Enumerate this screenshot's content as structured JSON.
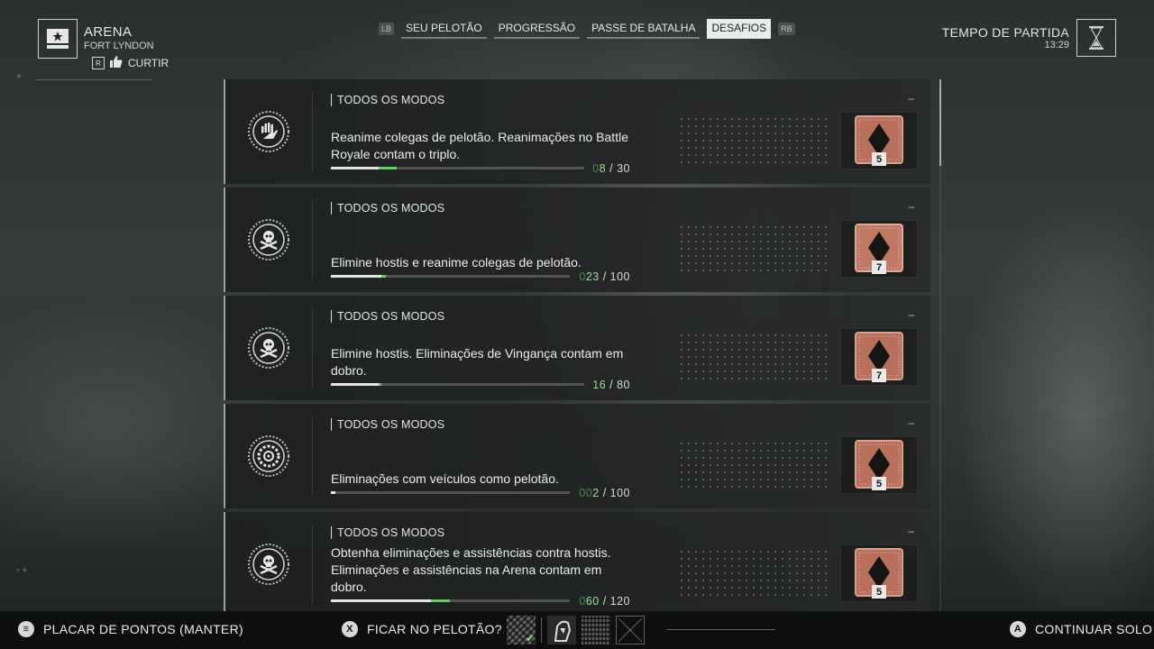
{
  "header": {
    "mode_title": "ARENA",
    "map_name": "FORT LYNDON",
    "like_key": "R",
    "like_label": "CURTIR"
  },
  "tabs": {
    "left_bumper": "LB",
    "right_bumper": "RB",
    "items": [
      {
        "label": "SEU PELOTÃO",
        "active": false
      },
      {
        "label": "PROGRESSÃO",
        "active": false
      },
      {
        "label": "PASSE DE BATALHA",
        "active": false
      },
      {
        "label": "DESAFIOS",
        "active": true
      }
    ]
  },
  "match_time": {
    "label": "TEMPO DE PARTIDA",
    "value": "13:29"
  },
  "challenges": [
    {
      "mode": "TODOS OS MODOS",
      "icon": "hand-revive-icon",
      "description": "Reanime colegas de pelotão. Reanimações no Battle Royale contam o triplo.",
      "current": "8",
      "current_prefix": "0",
      "total": "30",
      "progress": 0.27,
      "progress_gain": 0.07,
      "level": "5",
      "dash": "–"
    },
    {
      "mode": "TODOS OS MODOS",
      "icon": "skull-crossbones-icon",
      "description": "Elimine hostis e reanime colegas de pelotão.",
      "current": "23",
      "current_prefix": "0",
      "total": "100",
      "progress": 0.23,
      "progress_gain": 0.02,
      "level": "7",
      "dash": "–"
    },
    {
      "mode": "TODOS OS MODOS",
      "icon": "skull-crossbones-icon",
      "description": "Elimine hostis. Eliminações de Vingança contam em dobro.",
      "current": "16",
      "current_prefix": "",
      "total": "80",
      "progress": 0.2,
      "progress_gain": 0.01,
      "level": "7",
      "dash": "–"
    },
    {
      "mode": "TODOS OS MODOS",
      "icon": "vehicle-wheel-icon",
      "description": "Eliminações com veículos como pelotão.",
      "current": "2",
      "current_prefix": "00",
      "total": "100",
      "progress": 0.02,
      "progress_gain": 0.0,
      "level": "5",
      "dash": "–"
    },
    {
      "mode": "TODOS OS MODOS",
      "icon": "skull-crossbones-icon",
      "description": "Obtenha eliminações e assistências contra hostis. Eliminações e assistências na Arena contam em dobro.",
      "current": "60",
      "current_prefix": "0",
      "total": "120",
      "progress": 0.5,
      "progress_gain": 0.07,
      "level": "5",
      "dash": "–"
    }
  ],
  "footer": {
    "scoreboard_label": "PLACAR DE PONTOS (MANTER)",
    "stay_key": "X",
    "stay_label": "FICAR NO PELOTÃO?",
    "continue_key": "A",
    "continue_label": "CONTINUAR SOLO"
  },
  "colors": {
    "progress_green": "#5fd35f",
    "badge_bronze": "#b8705a"
  }
}
